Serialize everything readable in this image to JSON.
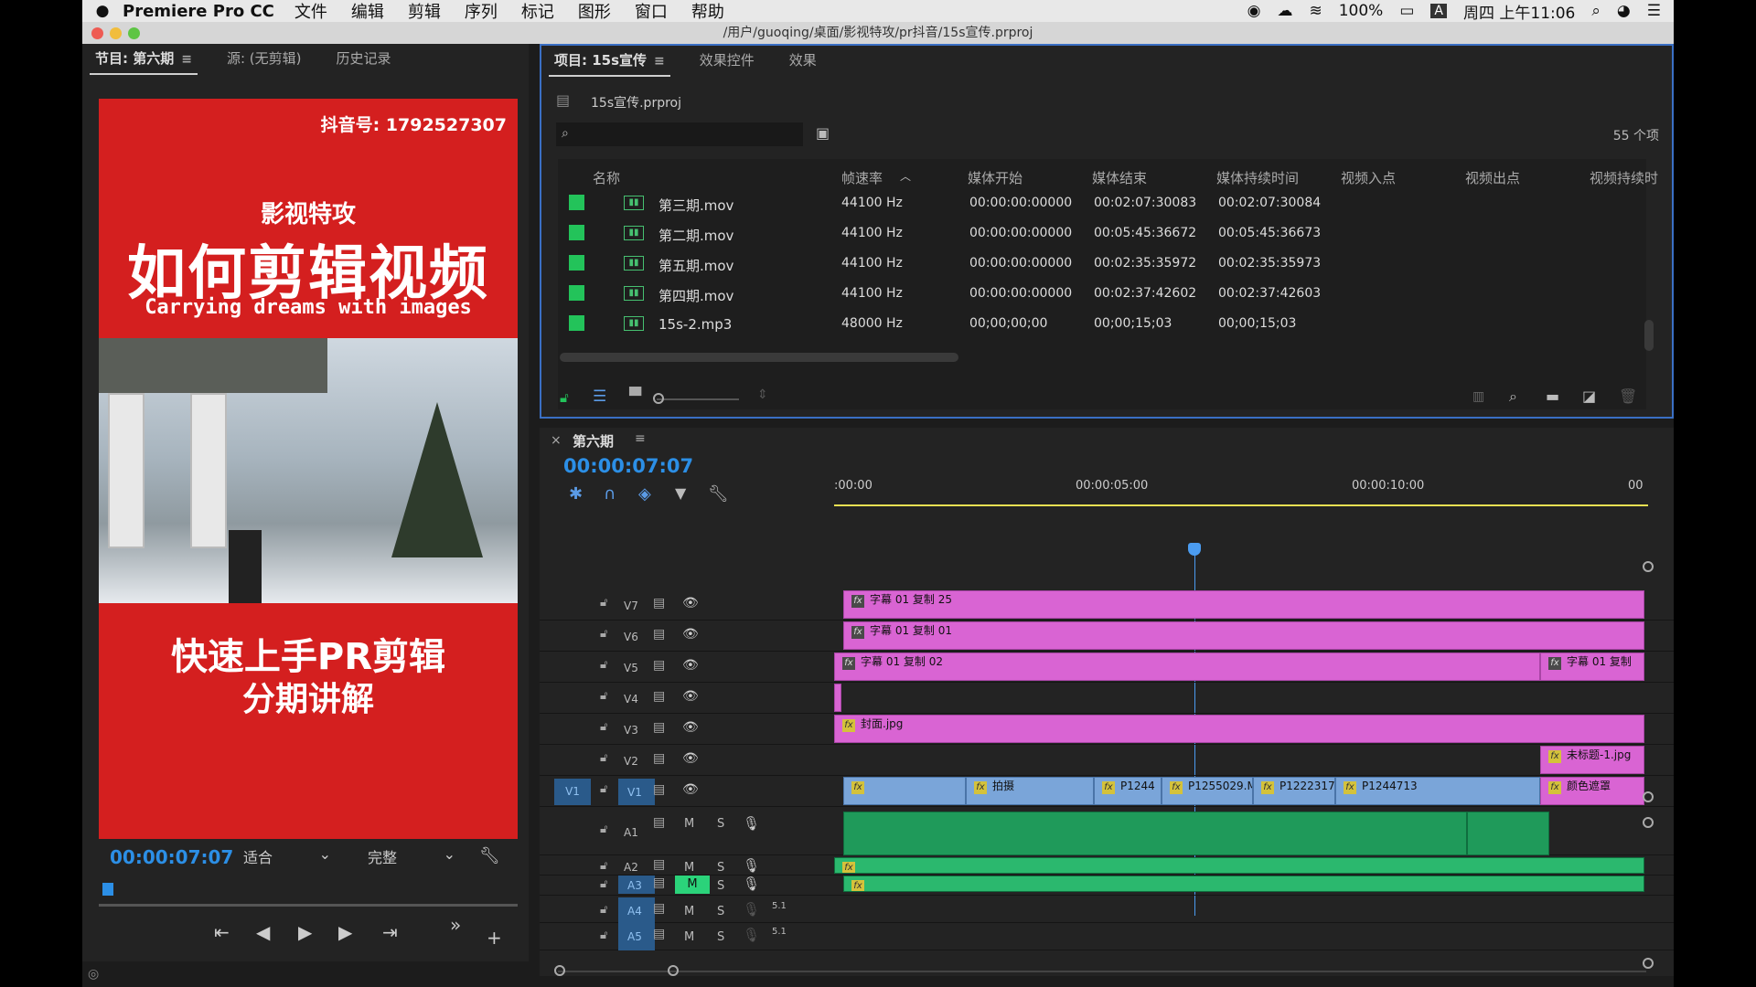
{
  "menubar": {
    "app": "Premiere Pro CC",
    "items": [
      "文件",
      "编辑",
      "剪辑",
      "序列",
      "标记",
      "图形",
      "窗口",
      "帮助"
    ],
    "battery": "100%",
    "input_method": "A",
    "clock": "周四 上午11:06"
  },
  "window_title": "/用户/guoqing/桌面/影视特攻/pr抖音/15s宣传.prproj",
  "program_monitor": {
    "tabs": [
      "节目: 第六期",
      "源: (无剪辑)",
      "历史记录"
    ],
    "video": {
      "douyin_id": "抖音号: 1792527307",
      "subtitle_top": "影视特攻",
      "headline": "如何剪辑视频",
      "tagline": "Carrying dreams with images",
      "bottom_line1": "快速上手PR剪辑",
      "bottom_line2": "分期讲解"
    },
    "timecode": "00:00:07:07",
    "fit": "适合",
    "quality": "完整"
  },
  "project": {
    "tabs": [
      "项目: 15s宣传",
      "效果控件",
      "效果"
    ],
    "file": "15s宣传.prproj",
    "search_placeholder": "",
    "count": "55 个项",
    "columns": [
      "名称",
      "帧速率",
      "媒体开始",
      "媒体结束",
      "媒体持续时间",
      "视频入点",
      "视频出点",
      "视频持续时"
    ],
    "rows": [
      {
        "name": "第三期.mov",
        "rate": "44100 Hz",
        "start": "00:00:00:00000",
        "end": "00:02:07:30083",
        "dur": "00:02:07:30084"
      },
      {
        "name": "第二期.mov",
        "rate": "44100 Hz",
        "start": "00:00:00:00000",
        "end": "00:05:45:36672",
        "dur": "00:05:45:36673"
      },
      {
        "name": "第五期.mov",
        "rate": "44100 Hz",
        "start": "00:00:00:00000",
        "end": "00:02:35:35972",
        "dur": "00:02:35:35973"
      },
      {
        "name": "第四期.mov",
        "rate": "44100 Hz",
        "start": "00:00:00:00000",
        "end": "00:02:37:42602",
        "dur": "00:02:37:42603"
      },
      {
        "name": "15s-2.mp3",
        "rate": "48000 Hz",
        "start": "00;00;00;00",
        "end": "00;00;15;03",
        "dur": "00;00;15;03"
      }
    ]
  },
  "timeline": {
    "sequence": "第六期",
    "timecode": "00:00:07:07",
    "ruler": [
      ":00:00",
      "00:00:05:00",
      "00:00:10:00",
      "00"
    ],
    "video_tracks": [
      {
        "id": "V7",
        "clips": [
          {
            "label": "字幕 01 复制 25"
          }
        ]
      },
      {
        "id": "V6",
        "clips": [
          {
            "label": "字幕 01 复制 01"
          }
        ]
      },
      {
        "id": "V5",
        "clips": [
          {
            "label": "字幕 01 复制 02"
          },
          {
            "label": "字幕 01 复制"
          }
        ]
      },
      {
        "id": "V4",
        "clips": []
      },
      {
        "id": "V3",
        "clips": [
          {
            "label": "封面.jpg"
          }
        ]
      },
      {
        "id": "V2",
        "clips": [
          {
            "label": "未标题-1.jpg"
          }
        ]
      },
      {
        "id": "V1",
        "clips": [
          {
            "label": "拍摄"
          },
          {
            "label": "P1244"
          },
          {
            "label": "P1255029.MP"
          },
          {
            "label": "P1222317"
          },
          {
            "label": "P1244713"
          },
          {
            "label": "颜色遮罩"
          }
        ]
      }
    ],
    "audio_tracks": [
      {
        "id": "A1",
        "m": "M",
        "s": "S"
      },
      {
        "id": "A2",
        "m": "M",
        "s": "S"
      },
      {
        "id": "A3",
        "m": "M",
        "s": "S"
      },
      {
        "id": "A4",
        "m": "M",
        "s": "S",
        "ch": "5.1"
      },
      {
        "id": "A5",
        "m": "M",
        "s": "S",
        "ch": "5.1"
      }
    ],
    "source_patch": "V1"
  },
  "colors": {
    "accent": "#2c8fe6",
    "pink_clip": "#d964d3",
    "blue_clip": "#7aa5d9",
    "green_clip": "#1f9a5a",
    "label_green": "#23c35a"
  }
}
